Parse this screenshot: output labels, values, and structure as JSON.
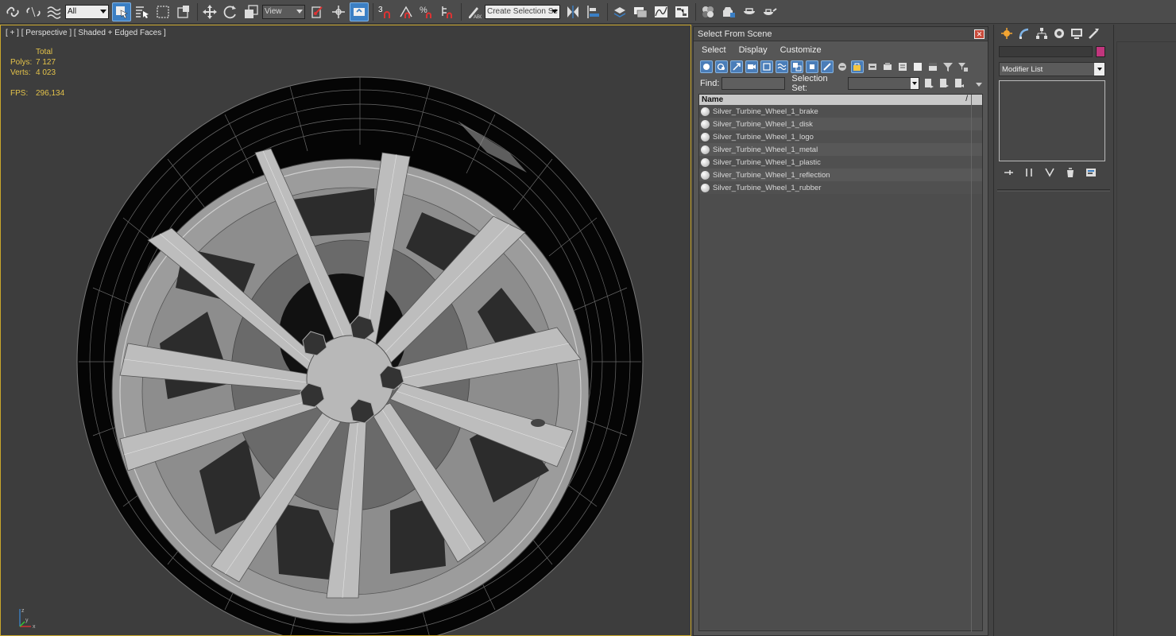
{
  "toolbar": {
    "filter_select": "All",
    "ref_coord_select": "View",
    "snap_label": "3",
    "named_selection_placeholder": "Create Selection Se"
  },
  "viewport": {
    "label": "[ + ] [ Perspective ] [ Shaded + Edged Faces ]",
    "stats": {
      "total_label": "Total",
      "polys_label": "Polys:",
      "polys_value": "7 127",
      "verts_label": "Verts:",
      "verts_value": "4 023",
      "fps_label": "FPS:",
      "fps_value": "296,134"
    },
    "axis": {
      "x": "x",
      "y": "y",
      "z": "z"
    }
  },
  "dialog": {
    "title": "Select From Scene",
    "close_glyph": "✕",
    "menu": [
      "Select",
      "Display",
      "Customize"
    ],
    "find_label": "Find:",
    "selection_set_label": "Selection Set:",
    "column_name": "Name",
    "sort_glyph": "/",
    "items": [
      "Silver_Turbine_Wheel_1_brake",
      "Silver_Turbine_Wheel_1_disk",
      "Silver_Turbine_Wheel_1_logo",
      "Silver_Turbine_Wheel_1_metal",
      "Silver_Turbine_Wheel_1_plastic",
      "Silver_Turbine_Wheel_1_reflection",
      "Silver_Turbine_Wheel_1_rubber"
    ]
  },
  "command_panel": {
    "modifier_list": "Modifier List",
    "object_color": "#c1367d"
  },
  "colors": {
    "viewport_border": "#c9a62b",
    "stats_text": "#e3c24a",
    "active_button": "#3b7fc4"
  }
}
